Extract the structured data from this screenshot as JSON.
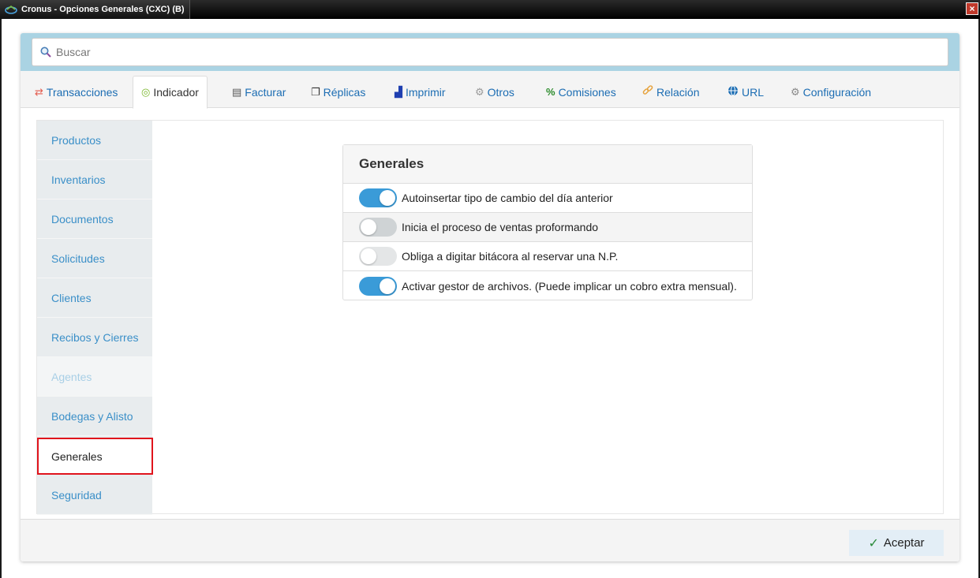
{
  "window": {
    "title": "Cronus - Opciones Generales (CXC) (B)",
    "close_icon": "×"
  },
  "search": {
    "placeholder": "Buscar"
  },
  "tabs": [
    {
      "label": "Transacciones",
      "icon": "⇄",
      "icon_name": "transfer-icon",
      "color": "#e35d4f"
    },
    {
      "label": "Indicador",
      "icon": "◎",
      "icon_name": "target-icon",
      "color": "#7cb82f"
    },
    {
      "label": "Facturar",
      "icon": "▤",
      "icon_name": "invoice-icon",
      "color": "#555555"
    },
    {
      "label": "Réplicas",
      "icon": "❐",
      "icon_name": "copies-icon",
      "color": "#333333"
    },
    {
      "label": "Imprimir",
      "icon": "▟",
      "icon_name": "chart-icon",
      "color": "#1f3fb0"
    },
    {
      "label": "Otros",
      "icon": "⚙",
      "icon_name": "gears-icon",
      "color": "#999999"
    },
    {
      "label": "Comisiones",
      "icon": "%",
      "icon_name": "percent-icon",
      "color": "#2a8a2a"
    },
    {
      "label": "Relación",
      "icon": "🔗",
      "icon_name": "link-icon",
      "color": "#e6a23c"
    },
    {
      "label": "URL",
      "icon": "🌐",
      "icon_name": "globe-icon",
      "color": "#1c6db3"
    },
    {
      "label": "Configuración",
      "icon": "⚙",
      "icon_name": "gear-icon",
      "color": "#888888"
    }
  ],
  "sidebar": {
    "items": [
      {
        "label": "Productos"
      },
      {
        "label": "Inventarios"
      },
      {
        "label": "Documentos"
      },
      {
        "label": "Solicitudes"
      },
      {
        "label": "Clientes"
      },
      {
        "label": "Recibos y Cierres"
      },
      {
        "label": "Agentes"
      },
      {
        "label": "Bodegas y Alisto"
      },
      {
        "label": "Generales"
      },
      {
        "label": "Seguridad"
      }
    ]
  },
  "card": {
    "title": "Generales",
    "options": [
      {
        "label": "Autoinsertar tipo de cambio del día anterior",
        "state": "on"
      },
      {
        "label": "Inicia el proceso de ventas proformando",
        "state": "off"
      },
      {
        "label": "Obliga a digitar bitácora al reservar una N.P.",
        "state": "disabled"
      },
      {
        "label": "Activar gestor de archivos. (Puede implicar un cobro extra mensual).",
        "state": "on"
      }
    ]
  },
  "footer": {
    "accept_label": "Aceptar",
    "accept_icon": "✓"
  },
  "colors": {
    "accent": "#3a9bd8",
    "link": "#1c6db3",
    "highlight": "#e0141c",
    "search_bar": "#aad3e3"
  }
}
